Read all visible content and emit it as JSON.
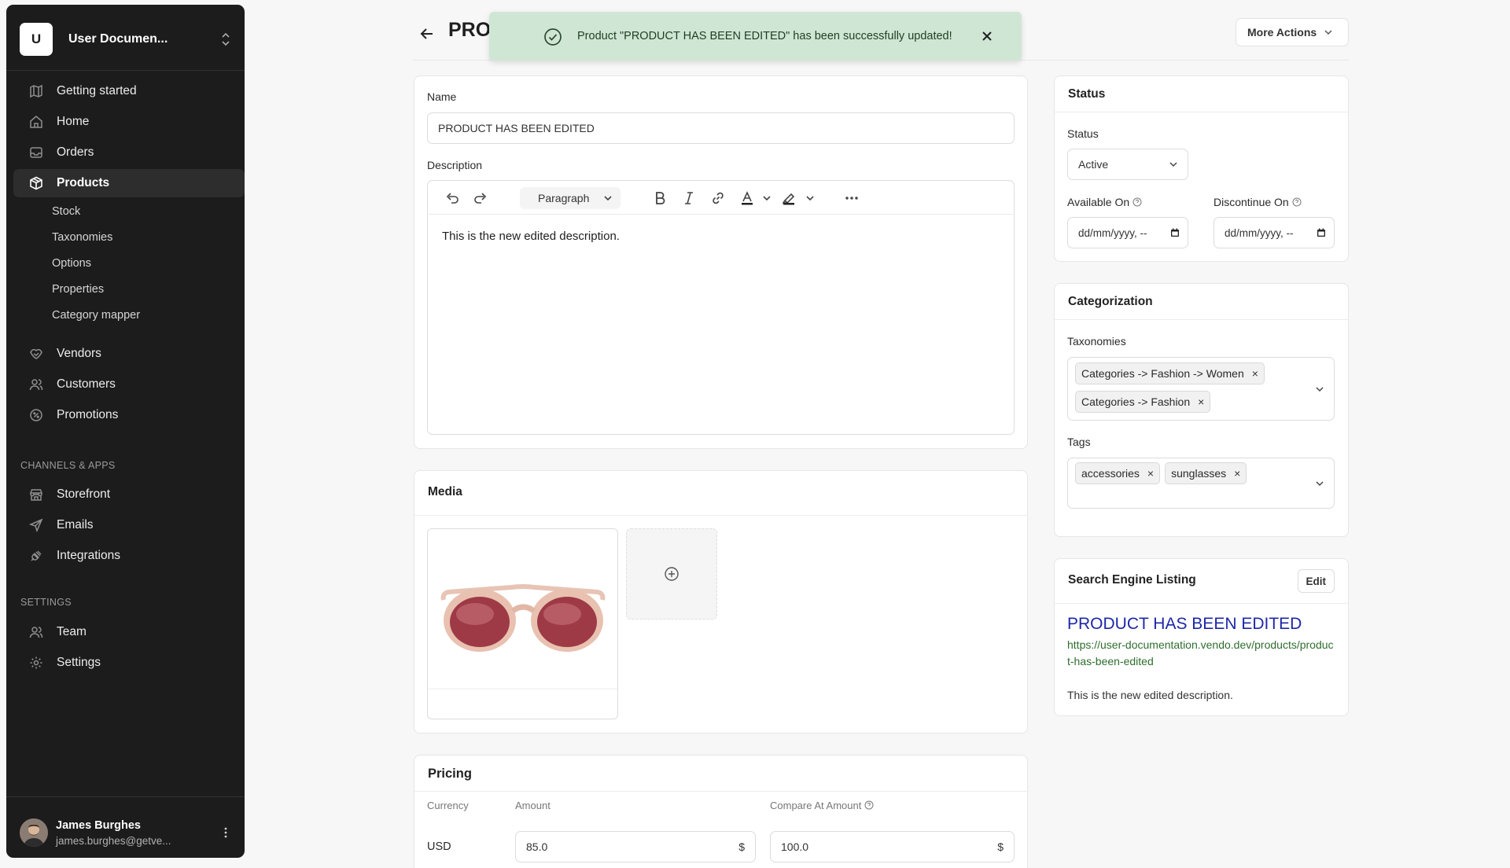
{
  "sidebar": {
    "store_initial": "U",
    "store_name": "User Documen...",
    "nav": [
      "Getting started",
      "Home",
      "Orders",
      "Products",
      "Vendors",
      "Customers",
      "Promotions"
    ],
    "products_sub": [
      "Stock",
      "Taxonomies",
      "Options",
      "Properties",
      "Category mapper"
    ],
    "channels_heading": "CHANNELS & APPS",
    "channels": [
      "Storefront",
      "Emails",
      "Integrations"
    ],
    "settings_heading": "SETTINGS",
    "settings": [
      "Team",
      "Settings"
    ],
    "user": {
      "name": "James Burghes",
      "email": "james.burghes@getve..."
    }
  },
  "header": {
    "title": "PRO",
    "more_actions": "More Actions"
  },
  "toast": {
    "message": "Product \"PRODUCT HAS BEEN EDITED\" has been successfully updated!"
  },
  "main": {
    "name_label": "Name",
    "name_value": "PRODUCT HAS BEEN EDITED",
    "description_label": "Description",
    "paragraph_select": "Paragraph",
    "description_text": "This is the new edited description.",
    "media_title": "Media",
    "pricing": {
      "title": "Pricing",
      "headers": [
        "Currency",
        "Amount",
        "Compare At Amount"
      ],
      "currency": "USD",
      "amount": "85.0",
      "amount_symbol": "$",
      "compare_amount": "100.0",
      "compare_symbol": "$"
    }
  },
  "status_card": {
    "title": "Status",
    "status_label": "Status",
    "status_value": "Active",
    "available_label": "Available On",
    "available_value": "dd/mm/yyyy, --",
    "discontinue_label": "Discontinue On",
    "discontinue_value": "dd/mm/yyyy, --"
  },
  "categorization": {
    "title": "Categorization",
    "taxonomies_label": "Taxonomies",
    "taxonomies": [
      "Categories -> Fashion -> Women",
      "Categories -> Fashion"
    ],
    "tags_label": "Tags",
    "tags": [
      "accessories",
      "sunglasses"
    ],
    "remove_symbol": "×"
  },
  "seo": {
    "title": "Search Engine Listing",
    "edit": "Edit",
    "listing_title": "PRODUCT HAS BEEN EDITED",
    "url": "https://user-documentation.vendo.dev/products/product-has-been-edited",
    "description": "This is the new edited description."
  },
  "colors": {
    "sidebar_bg": "#1c1c1c",
    "toast_bg": "#cfe6d4",
    "seo_link": "#1d27a8",
    "seo_url": "#2f6d2f"
  }
}
